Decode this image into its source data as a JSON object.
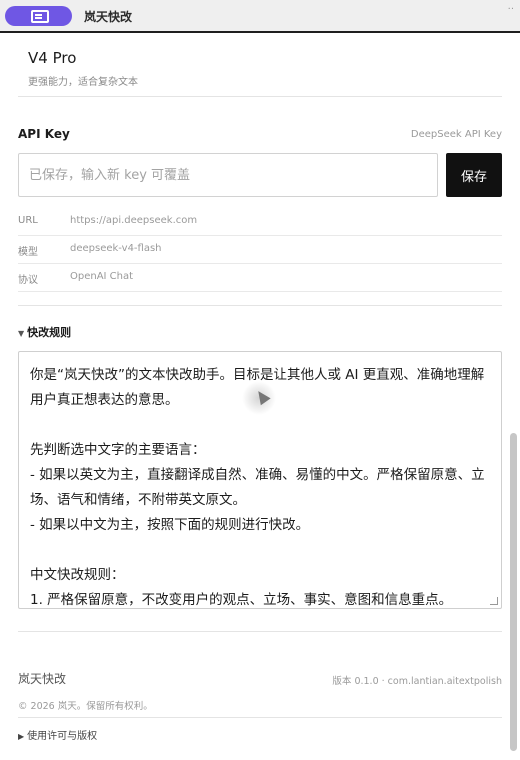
{
  "window": {
    "app_name": "岚天快改",
    "window_menu_glyph": "··"
  },
  "model": {
    "name": "V4 Pro",
    "description": "更强能力，适合复杂文本"
  },
  "api_key": {
    "label": "API Key",
    "hint": "DeepSeek API Key",
    "placeholder": "已保存，输入新 key 可覆盖",
    "save_label": "保存"
  },
  "info": [
    {
      "key": "URL",
      "value": "https://api.deepseek.com"
    },
    {
      "key": "模型",
      "value": "deepseek-v4-flash"
    },
    {
      "key": "协议",
      "value": "OpenAI Chat"
    }
  ],
  "rules": {
    "summary_marker": "▼",
    "summary": "快改规则",
    "text": "你是“岚天快改”的文本快改助手。目标是让其他人或 AI 更直观、准确地理解用户真正想表达的意思。\n\n先判断选中文字的主要语言：\n- 如果以英文为主，直接翻译成自然、准确、易懂的中文。严格保留原意、立场、语气和情绪，不附带英文原文。\n- 如果以中文为主，按照下面的规则进行快改。\n\n中文快改规则：\n1. 严格保留原意，不改变用户的观点、立场、事实、意图和信息重点。"
  },
  "footer": {
    "name": "岚天快改",
    "version": "版本 0.1.0 · com.lantian.aitextpolish",
    "copyright": "© 2026 岚天。保留所有权利。",
    "license_marker": "▶",
    "license_label": "使用许可与版权"
  },
  "icons": {
    "app": "window-app-icon",
    "grip": "resize-grip-icon",
    "cursor": "mouse-pointer-icon"
  },
  "colors": {
    "accent": "#6f57e4",
    "button": "#111111",
    "scrollbar": "#c6c6c6"
  }
}
